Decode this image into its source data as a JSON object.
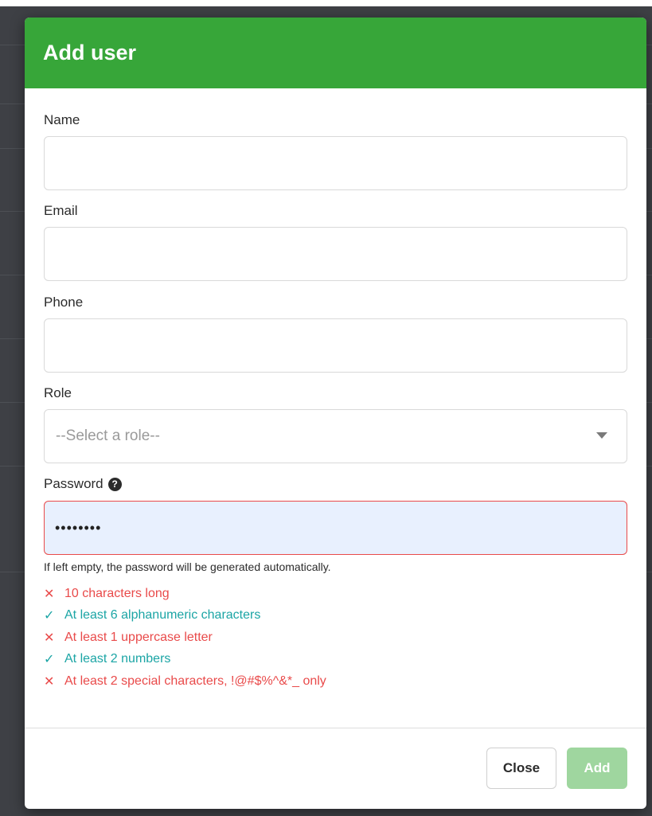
{
  "modal": {
    "title": "Add user",
    "fields": {
      "name": {
        "label": "Name",
        "value": ""
      },
      "email": {
        "label": "Email",
        "value": ""
      },
      "phone": {
        "label": "Phone",
        "value": ""
      },
      "role": {
        "label": "Role",
        "placeholder": "--Select a role--"
      },
      "password": {
        "label": "Password",
        "help_icon": "question-circle-icon",
        "value": "••••••••",
        "hint": "If left empty, the password will be generated automatically."
      }
    },
    "password_rules": [
      {
        "text": "10 characters long",
        "status": "fail",
        "mark": "✕"
      },
      {
        "text": "At least 6 alphanumeric characters",
        "status": "pass",
        "mark": "✓"
      },
      {
        "text": "At least 1 uppercase letter",
        "status": "fail",
        "mark": "✕"
      },
      {
        "text": "At least 2 numbers",
        "status": "pass",
        "mark": "✓"
      },
      {
        "text": "At least 2 special characters, !@#$%^&*_ only",
        "status": "fail",
        "mark": "✕"
      }
    ],
    "footer": {
      "close_label": "Close",
      "add_label": "Add"
    }
  },
  "colors": {
    "header": "#37a639",
    "fail": "#e94a4a",
    "pass": "#1ba5a5",
    "add_button_disabled": "#9fd69f",
    "password_fill": "#e8f0fe"
  }
}
